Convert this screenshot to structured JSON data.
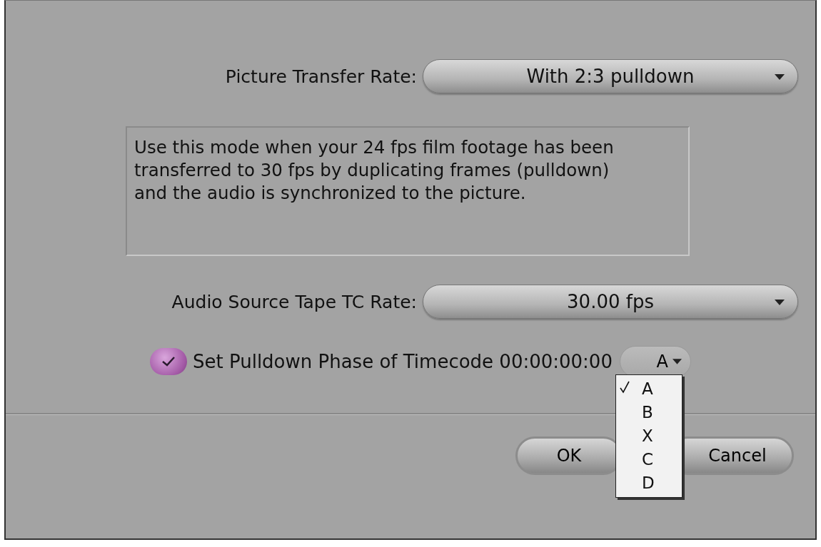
{
  "picture_transfer_rate": {
    "label": "Picture Transfer Rate:",
    "value": "With 2:3 pulldown"
  },
  "description": "Use this mode when your 24 fps film footage has been\ntransferred to 30 fps by duplicating frames (pulldown)\nand the audio is synchronized to the picture.",
  "audio_source_tape_tc_rate": {
    "label": "Audio Source Tape TC Rate:",
    "value": "30.00 fps"
  },
  "pulldown_phase": {
    "checked": true,
    "label": "Set Pulldown Phase of Timecode 00:00:00:00",
    "value": "A",
    "menu": [
      {
        "label": "A",
        "selected": true
      },
      {
        "label": "B",
        "selected": false
      },
      {
        "label": "X",
        "selected": false
      },
      {
        "label": "C",
        "selected": false
      },
      {
        "label": "D",
        "selected": false
      }
    ]
  },
  "buttons": [
    "OK",
    "Cancel"
  ]
}
